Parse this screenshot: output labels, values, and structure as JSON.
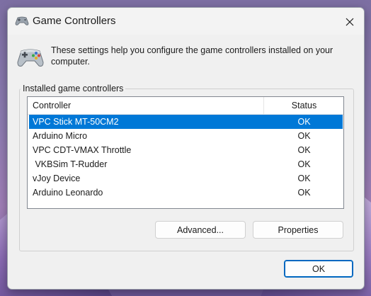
{
  "window": {
    "title": "Game Controllers",
    "title_icon": "gamepad-icon",
    "close_icon": "close-icon"
  },
  "header": {
    "icon": "gamepad-icon",
    "description": "These settings help you configure the game controllers installed on your computer."
  },
  "group": {
    "label": "Installed game controllers"
  },
  "table": {
    "columns": [
      "Controller",
      "Status"
    ],
    "rows": [
      {
        "name": "VPC Stick MT-50CM2",
        "status": "OK",
        "selected": true
      },
      {
        "name": "Arduino Micro",
        "status": "OK",
        "selected": false
      },
      {
        "name": "VPC CDT-VMAX Throttle",
        "status": "OK",
        "selected": false
      },
      {
        "name": " VKBSim T-Rudder",
        "status": "OK",
        "selected": false
      },
      {
        "name": "vJoy Device",
        "status": "OK",
        "selected": false
      },
      {
        "name": "Arduino Leonardo",
        "status": "OK",
        "selected": false
      }
    ]
  },
  "buttons": {
    "advanced": "Advanced...",
    "properties": "Properties",
    "ok": "OK"
  },
  "colors": {
    "selection": "#0078d7",
    "dialog_bg": "#f0f0f0",
    "ok_border": "#0067c0"
  }
}
